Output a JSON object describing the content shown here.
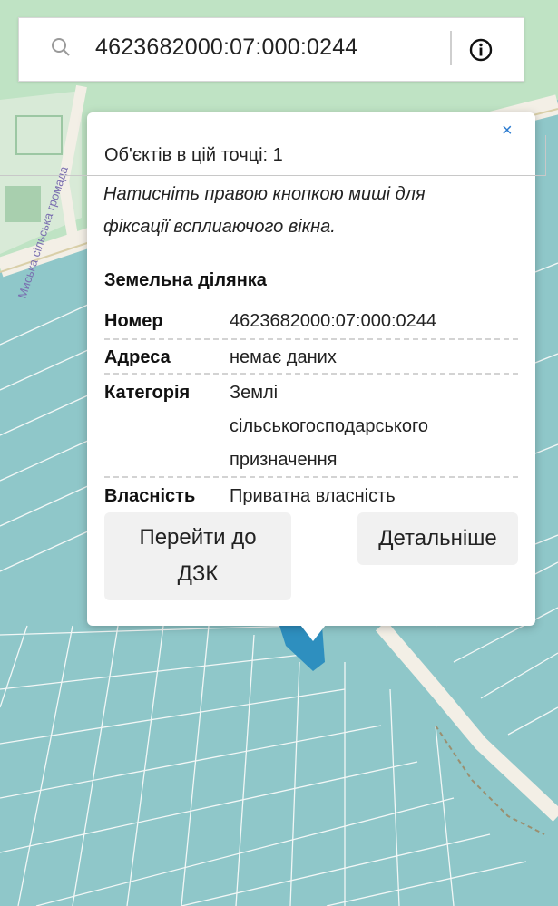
{
  "search": {
    "query": "4623682000:07:000:0244"
  },
  "icons": {
    "search": "search-icon",
    "info": "info-icon",
    "close": "close-icon"
  },
  "map": {
    "road_label": "Миська сільська громада"
  },
  "popup": {
    "close_label": "×",
    "objects_count": "Об'єктів в цій точці: 1",
    "hint_line1": "Натисніть правою кнопкою миші для",
    "hint_line2": "фіксації всплиаючого вікна.",
    "section_title": "Земельна ділянка",
    "rows": [
      {
        "label": "Номер",
        "value": "4623682000:07:000:0244"
      },
      {
        "label": "Адреса",
        "value": "немає даних"
      },
      {
        "label": "Категорія",
        "value_lines": [
          "Землі",
          "сільськогосподарського",
          "призначення"
        ]
      },
      {
        "label": "Власність",
        "value": "Приватна власність"
      }
    ],
    "goto_button": {
      "line1": "Перейти до",
      "line2": "ДЗК"
    },
    "details_button": "Детальніше"
  },
  "colors": {
    "parcel_fill": "#8fc7c9",
    "parcel_line": "#f2f7f6",
    "green_area": "#bfe3c4",
    "road": "#f3efe6",
    "highlight_parcel": "#2e8fbf",
    "link": "#2b7bd0"
  }
}
